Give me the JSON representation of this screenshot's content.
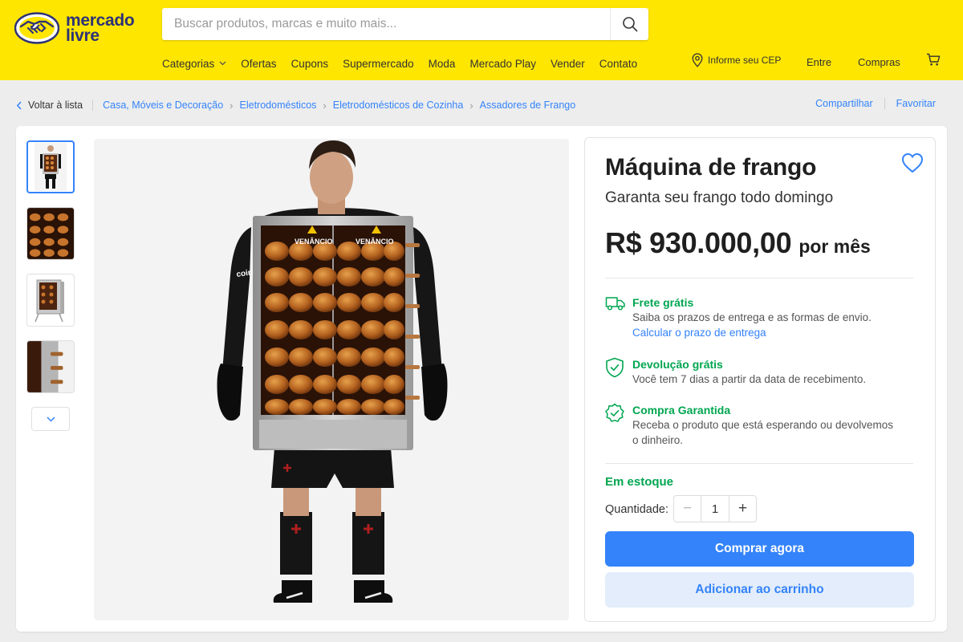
{
  "brand": {
    "line1": "mercado",
    "line2": "livre",
    "color": "#ffe600",
    "ink": "#2d3277"
  },
  "search": {
    "placeholder": "Buscar produtos, marcas e muito mais..."
  },
  "nav": [
    "Categorias",
    "Ofertas",
    "Cupons",
    "Supermercado",
    "Moda",
    "Mercado Play",
    "Vender",
    "Contato"
  ],
  "header_links": {
    "cep": "Informe seu CEP",
    "login": "Entre",
    "purchases": "Compras"
  },
  "breadcrumb": {
    "back": "Voltar à lista",
    "items": [
      "Casa, Móveis e Decoração",
      "Eletrodomésticos",
      "Eletrodomésticos de Cozinha",
      "Assadores de Frango"
    ],
    "share": "Compartilhar",
    "favorite": "Favoritar"
  },
  "product": {
    "title": "Máquina de frango",
    "subtitle": "Garanta seu frango todo domingo",
    "price": "R$ 930.000,00",
    "price_suffix": "por mês",
    "machine_brand": "VENÂNCIO",
    "jersey_text": "coin"
  },
  "benefits": [
    {
      "title": "Frete grátis",
      "text": "Saiba os prazos de entrega e as formas de envio.",
      "link": "Calcular o prazo de entrega",
      "icon": "truck-icon"
    },
    {
      "title": "Devolução grátis",
      "text": "Você tem 7 dias a partir da data de recebimento.",
      "icon": "shield-check-icon"
    },
    {
      "title": "Compra Garantida",
      "text1": "Receba o produto que está esperando ou devolvemos",
      "text2": "o dinheiro.",
      "icon": "badge-check-icon"
    }
  ],
  "stock": "Em estoque",
  "quantity": {
    "label": "Quantidade:",
    "value": "1",
    "minus": "−",
    "plus": "+"
  },
  "buttons": {
    "buy": "Comprar agora",
    "cart": "Adicionar ao carrinho"
  },
  "colors": {
    "accent": "#3483fa",
    "success": "#00a650"
  }
}
